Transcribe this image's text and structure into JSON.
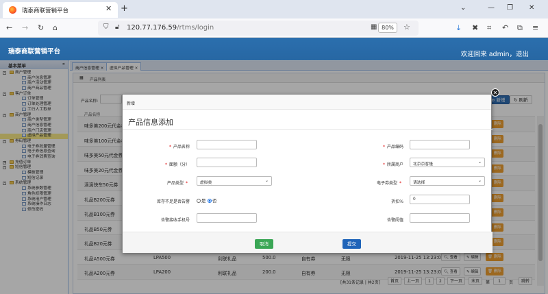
{
  "browser": {
    "tab_title": "瑞泰商联营销平台",
    "url_host": "120.77.176.59",
    "url_path": "/rtms/login",
    "zoom": "80%"
  },
  "app": {
    "title": "瑞泰商联营销平台",
    "welcome": "欢迎回来 admin，退出"
  },
  "sidebar": {
    "header": "基本菜单",
    "items": [
      {
        "label": "商户管理",
        "level": 1,
        "sign": "-"
      },
      {
        "label": "商户信息管理",
        "level": 2
      },
      {
        "label": "商户活动管理",
        "level": 2
      },
      {
        "label": "商户商品管理",
        "level": 2
      },
      {
        "label": "客户订单",
        "level": 1,
        "sign": "-"
      },
      {
        "label": "订单管理",
        "level": 2
      },
      {
        "label": "订单处理管理",
        "level": 2
      },
      {
        "label": "工行人工取单",
        "level": 2
      },
      {
        "label": "商户管理",
        "level": 1,
        "sign": "-"
      },
      {
        "label": "商户类型管理",
        "level": 2
      },
      {
        "label": "商户信息管理",
        "level": 2
      },
      {
        "label": "商户门店管理",
        "level": 2
      },
      {
        "label": "虚拟产品管理",
        "level": 2,
        "selected": true
      },
      {
        "label": "券码管理",
        "level": 1,
        "sign": "-"
      },
      {
        "label": "电子券批量管理",
        "level": 2
      },
      {
        "label": "电子券信息查询",
        "level": 2
      },
      {
        "label": "电子券消费查询",
        "level": 2
      },
      {
        "label": "充值订单",
        "level": 1,
        "sign": "+"
      },
      {
        "label": "短信管理",
        "level": 1,
        "sign": "-"
      },
      {
        "label": "模板管理",
        "level": 2
      },
      {
        "label": "短信记录",
        "level": 2
      },
      {
        "label": "系统管理",
        "level": 1,
        "sign": "-"
      },
      {
        "label": "系统参数管理",
        "level": 2
      },
      {
        "label": "角色权限管理",
        "level": 2
      },
      {
        "label": "系统用户管理",
        "level": 2
      },
      {
        "label": "系统操作日志",
        "level": 2
      },
      {
        "label": "修改密码",
        "level": 2
      }
    ]
  },
  "tabs": [
    {
      "label": "商户信息管理 ×"
    },
    {
      "label": "虚拟产品管理 ×"
    }
  ],
  "panel": {
    "title": "产品列表",
    "search_label": "产品名称:",
    "add_label": "新增",
    "refresh_label": "刷新",
    "column_header": "产品名称"
  },
  "table": {
    "rows": [
      {
        "name": "味多美200元代金券",
        "code": "",
        "type": "",
        "price": "",
        "supplier": "",
        "stock": "",
        "time": ""
      },
      {
        "name": "味多美100元代金券",
        "code": "",
        "type": "",
        "price": "",
        "supplier": "",
        "stock": "",
        "time": ""
      },
      {
        "name": "味多美50元代金券",
        "code": "",
        "type": "",
        "price": "",
        "supplier": "",
        "stock": "",
        "time": ""
      },
      {
        "name": "味多美20元代金券",
        "code": "",
        "type": "",
        "price": "",
        "supplier": "",
        "stock": "",
        "time": ""
      },
      {
        "name": "滴滴快车50元券",
        "code": "",
        "type": "",
        "price": "",
        "supplier": "",
        "stock": "",
        "time": ""
      },
      {
        "name": "礼品B200元券",
        "code": "",
        "type": "",
        "price": "",
        "supplier": "",
        "stock": "",
        "time": ""
      },
      {
        "name": "礼品B100元券",
        "code": "",
        "type": "",
        "price": "",
        "supplier": "",
        "stock": "",
        "time": ""
      },
      {
        "name": "礼品B50元券",
        "code": "",
        "type": "",
        "price": "",
        "supplier": "",
        "stock": "",
        "time": ""
      },
      {
        "name": "礼品B20元券",
        "code": "",
        "type": "",
        "price": "",
        "supplier": "",
        "stock": "",
        "time": ""
      },
      {
        "name": "礼品A500元券",
        "code": "LPA500",
        "type": "利联礼品",
        "price": "500.0",
        "supplier": "自有券",
        "stock": "无限",
        "time": "2019-11-25 13:23:00"
      },
      {
        "name": "礼品A200元券",
        "code": "LPA200",
        "type": "利联礼品",
        "price": "200.0",
        "supplier": "自有券",
        "stock": "无限",
        "time": "2019-11-25 13:23:00"
      }
    ],
    "view_label": "查看",
    "edit_label": "编辑",
    "delete_label": "删除"
  },
  "pager": {
    "summary": "[共31条记录 | 共2页]",
    "first": "首页",
    "prev": "上一页",
    "p1": "1",
    "p2": "2",
    "next": "下一页",
    "last": "末页",
    "jump_prefix": "第",
    "jump_value": "1",
    "jump_suffix": "页",
    "go": "跳转"
  },
  "modal": {
    "header": "新增",
    "title": "产品信息添加",
    "fields": {
      "name_label": "产品名称",
      "code_label": "产品编码",
      "amount_label": "面额（分）",
      "merchant_label": "所属商户",
      "merchant_value": "北京京客隆",
      "type_label": "产品类型",
      "type_value": "虚拟类",
      "ecoupon_label": "电子券类型",
      "ecoupon_value": "请选择",
      "stock_warn_label": "库存不足是否告警",
      "radio_yes": "是",
      "radio_no": "否",
      "discount_label": "折扣%",
      "discount_value": "0",
      "phone_label": "告警接收手机号",
      "threshold_label": "告警阈值"
    },
    "cancel": "取消",
    "submit": "提交"
  }
}
